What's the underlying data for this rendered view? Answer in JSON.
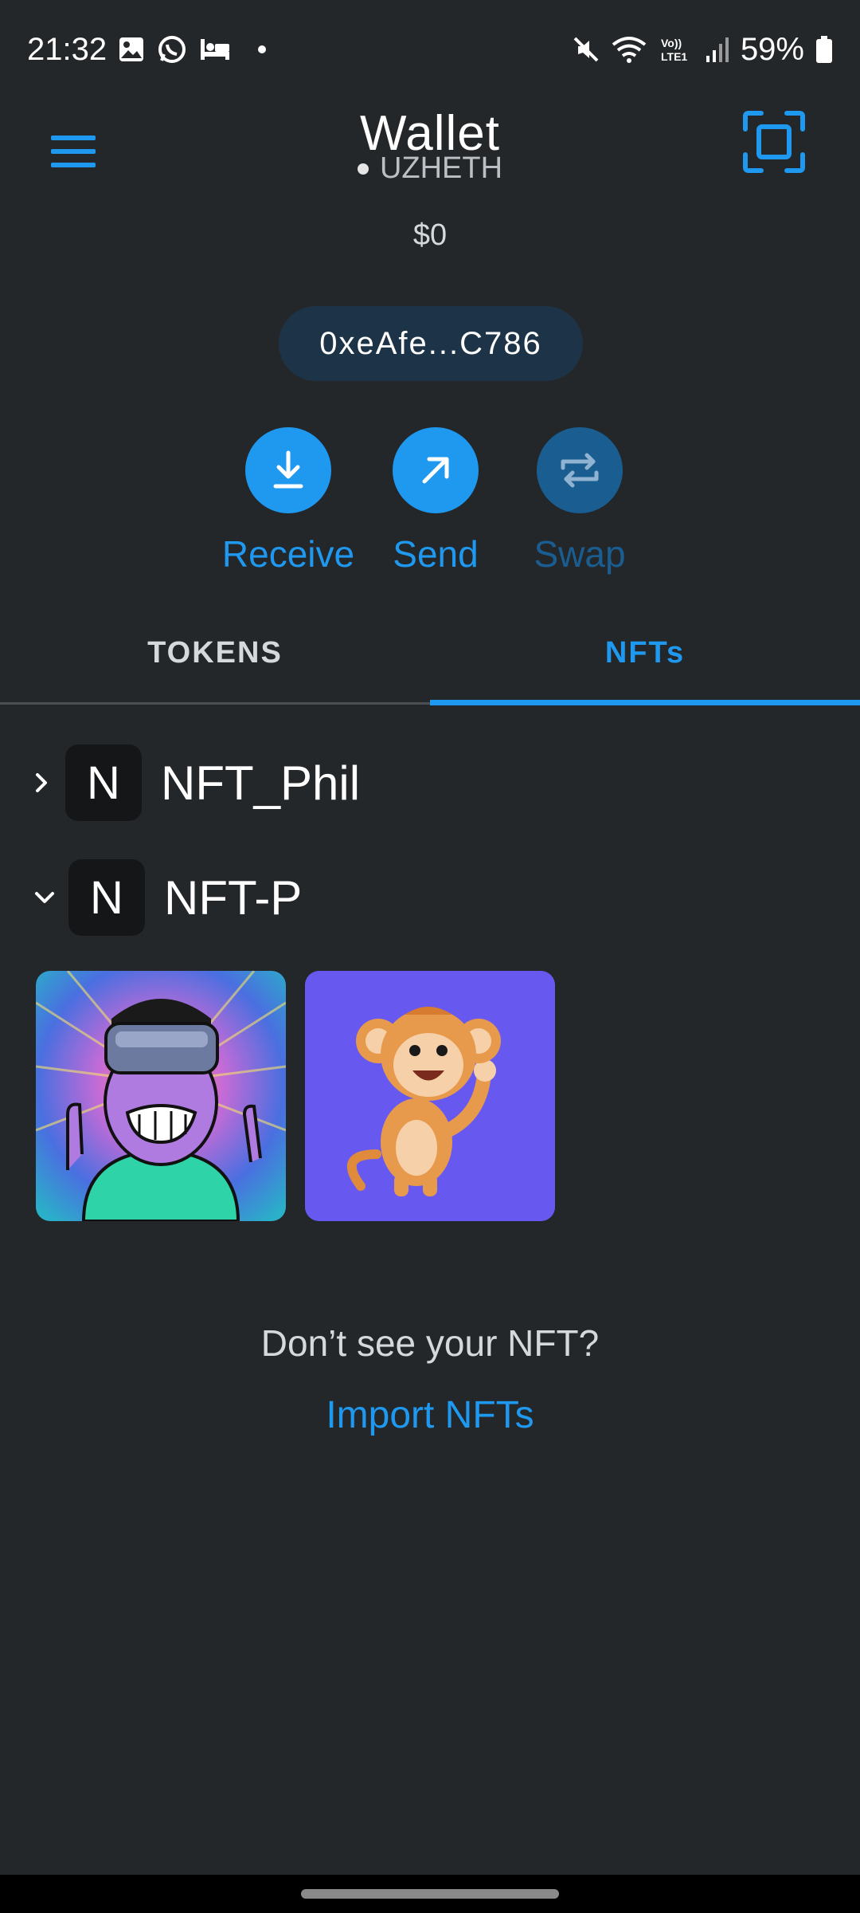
{
  "status_bar": {
    "time": "21:32",
    "battery": "59%",
    "icons_left": [
      "gallery-icon",
      "whatsapp-icon",
      "sleep-icon"
    ],
    "icons_right": [
      "mute-icon",
      "wifi-icon",
      "volte-icon",
      "signal-icon",
      "battery-icon"
    ]
  },
  "header": {
    "title": "Wallet",
    "network": "UZHETH",
    "balance": "$0",
    "address": "0xeAfe...C786"
  },
  "actions": [
    {
      "label": "Receive",
      "icon": "download-icon",
      "enabled": true
    },
    {
      "label": "Send",
      "icon": "arrow-up-right-icon",
      "enabled": true
    },
    {
      "label": "Swap",
      "icon": "swap-icon",
      "enabled": false
    }
  ],
  "tabs": [
    {
      "label": "TOKENS",
      "active": false
    },
    {
      "label": "NFTs",
      "active": true
    }
  ],
  "collections": [
    {
      "initial": "N",
      "name": "NFT_Phil",
      "expanded": false
    },
    {
      "initial": "N",
      "name": "NFT-P",
      "expanded": true
    }
  ],
  "nft_images": [
    "vr-headset-character-nft",
    "monkey-nft"
  ],
  "empty_prompt": {
    "question": "Don’t see your NFT?",
    "link": "Import NFTs"
  },
  "colors": {
    "background": "#24272a",
    "accent": "#1f98f0",
    "accent_disabled": "#1a5d91",
    "pill": "#1d3448"
  }
}
